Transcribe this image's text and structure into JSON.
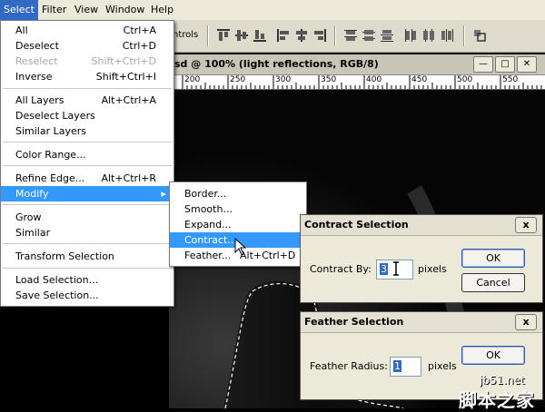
{
  "menubar": {
    "items": [
      "Select",
      "Filter",
      "View",
      "Window",
      "Help"
    ]
  },
  "options_bar": {
    "partial_label": "ntrols"
  },
  "document": {
    "title": "sd @ 100% (light reflections, RGB/8)",
    "ruler_labels": [
      "200",
      "250",
      "300",
      "350",
      "400",
      "450",
      "500",
      "550"
    ]
  },
  "select_menu": {
    "items": [
      {
        "label": "All",
        "shortcut": "Ctrl+A"
      },
      {
        "label": "Deselect",
        "shortcut": "Ctrl+D"
      },
      {
        "label": "Reselect",
        "shortcut": "Shift+Ctrl+D",
        "disabled": true
      },
      {
        "label": "Inverse",
        "shortcut": "Shift+Ctrl+I"
      },
      {
        "label": "All Layers",
        "shortcut": "Alt+Ctrl+A"
      },
      {
        "label": "Deselect Layers",
        "shortcut": ""
      },
      {
        "label": "Similar Layers",
        "shortcut": ""
      },
      {
        "label": "Color Range...",
        "shortcut": ""
      },
      {
        "label": "Refine Edge...",
        "shortcut": "Alt+Ctrl+R"
      },
      {
        "label": "Modify",
        "shortcut": ""
      },
      {
        "label": "Grow",
        "shortcut": ""
      },
      {
        "label": "Similar",
        "shortcut": ""
      },
      {
        "label": "Transform Selection",
        "shortcut": ""
      },
      {
        "label": "Load Selection...",
        "shortcut": ""
      },
      {
        "label": "Save Selection...",
        "shortcut": ""
      }
    ]
  },
  "modify_submenu": {
    "items": [
      "Border...",
      "Smooth...",
      "Expand...",
      "Contract...",
      "Feather..."
    ],
    "feather_shortcut": "Alt+Ctrl+D"
  },
  "contract_dialog": {
    "title": "Contract Selection",
    "field_label": "Contract By:",
    "value": "3",
    "unit": "pixels",
    "ok_label": "OK",
    "cancel_label": "Cancel",
    "close_label": "x"
  },
  "feather_dialog": {
    "title": "Feather Selection",
    "field_label": "Feather Radius:",
    "value": "1",
    "unit": "pixels",
    "ok_label": "OK",
    "close_label": "x"
  },
  "watermark": {
    "site": "jb51.net",
    "text": "脚本之家"
  },
  "colors": {
    "highlight": "#3399ff",
    "menubar": "#ece9d8",
    "canvas": "#050505"
  }
}
